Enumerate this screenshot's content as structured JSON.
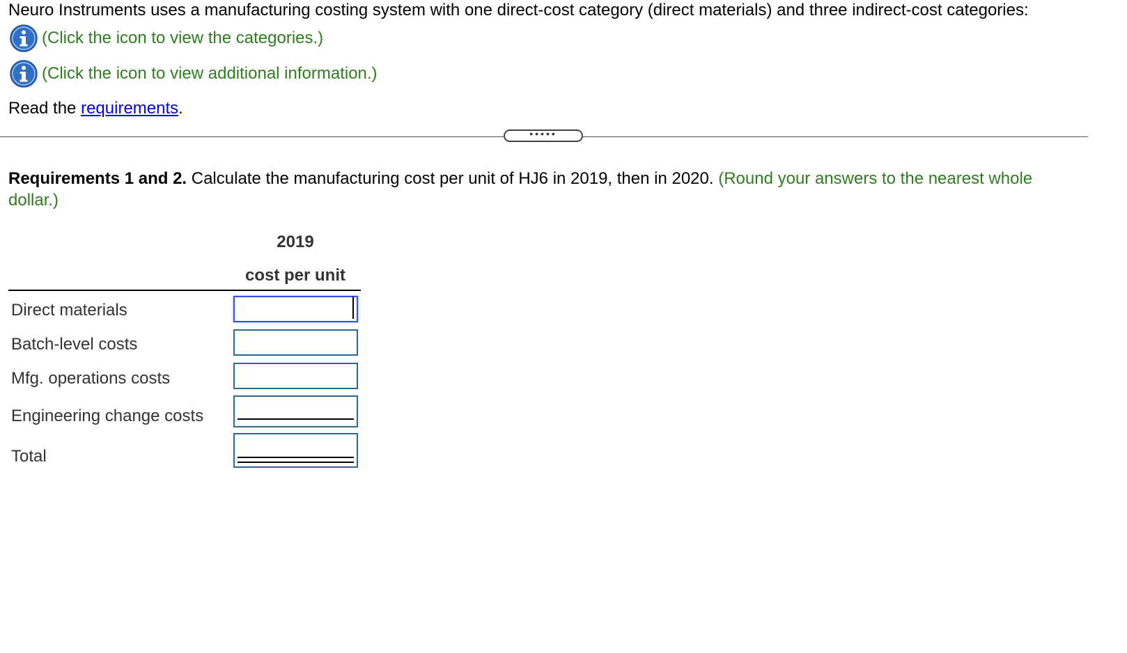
{
  "intro": {
    "text": "Neuro Instruments uses a manufacturing costing system with one direct-cost category (direct materials) and three indirect-cost categories:"
  },
  "info_links": [
    {
      "icon": "info-icon",
      "text": "(Click the icon to view the categories.)"
    },
    {
      "icon": "info-icon",
      "text": "(Click the icon to view additional information.)"
    }
  ],
  "read_line": {
    "prefix": "Read the ",
    "link": "requirements",
    "suffix": "."
  },
  "divider": {
    "handle_label": "•••••"
  },
  "requirement": {
    "bold": "Requirements 1 and 2.",
    "text": " Calculate the manufacturing cost per unit of HJ6 in 2019, then in 2020. ",
    "hint": "(Round your answers to the nearest whole dollar.)"
  },
  "table": {
    "year_header": "2019",
    "column_header": "cost per unit",
    "rows": [
      {
        "label": "Direct materials",
        "value": ""
      },
      {
        "label": "Batch-level costs",
        "value": ""
      },
      {
        "label": "Mfg. operations costs",
        "value": ""
      },
      {
        "label": "Engineering change costs",
        "value": ""
      },
      {
        "label": "Total",
        "value": ""
      }
    ]
  },
  "colors": {
    "hint_green": "#2e7d1e",
    "link_blue": "#0000ee",
    "input_border": "#2b6a8e",
    "info_icon_blue": "#2f6fc8"
  }
}
